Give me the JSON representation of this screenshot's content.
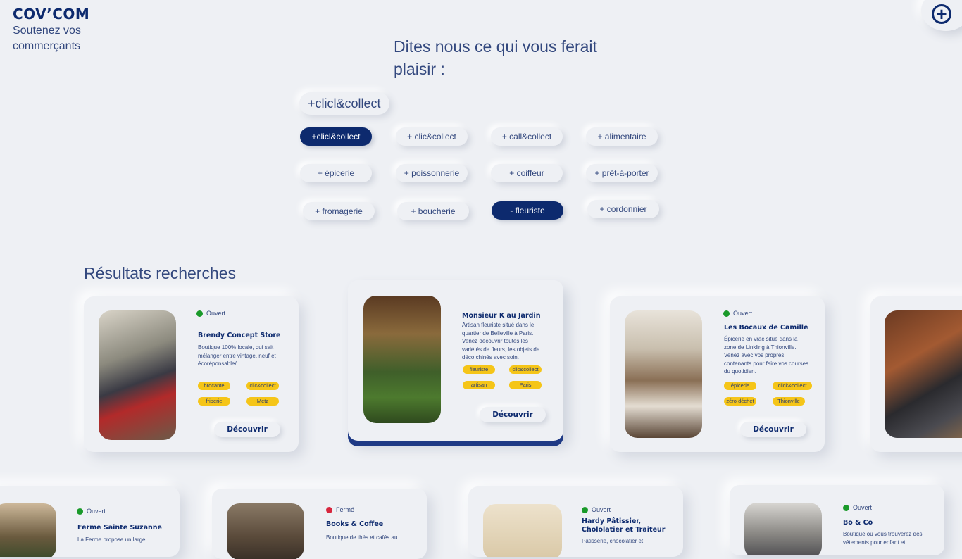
{
  "brand": {
    "logo": "COV’COM",
    "tagline": "Soutenez vos commerçants"
  },
  "header": {
    "add_icon": "plus-circle-icon"
  },
  "prompt": {
    "text": "Dites nous ce qui vous ferait plaisir :"
  },
  "search": {
    "current": "+clicl&collect"
  },
  "chips": [
    {
      "label": "+clicl&collect",
      "active": true
    },
    {
      "label": "+ clic&collect",
      "active": false
    },
    {
      "label": "+ call&collect",
      "active": false
    },
    {
      "label": "+ alimentaire",
      "active": false
    },
    {
      "label": "+ épicerie",
      "active": false
    },
    {
      "label": "+ poissonnerie",
      "active": false
    },
    {
      "label": "+ coiffeur",
      "active": false
    },
    {
      "label": "+ prêt-à-porter",
      "active": false
    },
    {
      "label": "+ fromagerie",
      "active": false
    },
    {
      "label": "+ boucherie",
      "active": false
    },
    {
      "label": "- fleuriste",
      "active": true
    },
    {
      "label": "+ cordonnier",
      "active": false
    }
  ],
  "results": {
    "title": "Résultats recherches",
    "discover_label": "Découvrir",
    "cards": [
      {
        "status": "Ouvert",
        "name": "Brendy Concept Store",
        "desc": "Boutique 100% locale, qui sait mélanger entre vintage, neuf et écoréponsable/",
        "tags": [
          "brocante",
          "clic&collect",
          "friperie",
          "Metz"
        ]
      },
      {
        "status": "",
        "name": "Monsieur K au Jardin",
        "desc": "Artisan fleuriste situé dans le quartier de Belleville à Paris. Venez découvrir toutes les variétés de fleurs, les objets de déco chinés avec soin.",
        "tags": [
          "fleuriste",
          "clic&collect",
          "artisan",
          "Paris"
        ]
      },
      {
        "status": "Ouvert",
        "name": "Les Bocaux de Camille",
        "desc": "Épicerie en vrac situé dans la zone de Linkling à Thionville. Venez avec vos propres contenants pour faire vos courses du quotidien.",
        "tags": [
          "épicerie",
          "click&collect",
          "zéro déchet",
          "Thionville"
        ]
      },
      {
        "status": "Ouvert",
        "name": "Ferme Sainte Suzanne",
        "desc": "La Ferme propose un large"
      },
      {
        "status": "Fermé",
        "name": "Books & Coffee",
        "desc": "Boutique de thés et cafés au"
      },
      {
        "status": "Ouvert",
        "name": "Hardy Pâtissier, Chololatier et Traiteur",
        "desc": "Pâtisserie, chocolatier et"
      },
      {
        "status": "Ouvert",
        "name": "Bo & Co",
        "desc": "Boutique où vous trouverez des vêtements pour enfant et"
      }
    ]
  },
  "colors": {
    "navy": "#0d2a6e",
    "tag_yellow": "#f5c518",
    "open_green": "#1a9a2a",
    "closed_red": "#d7263d",
    "background": "#eef0f4"
  }
}
